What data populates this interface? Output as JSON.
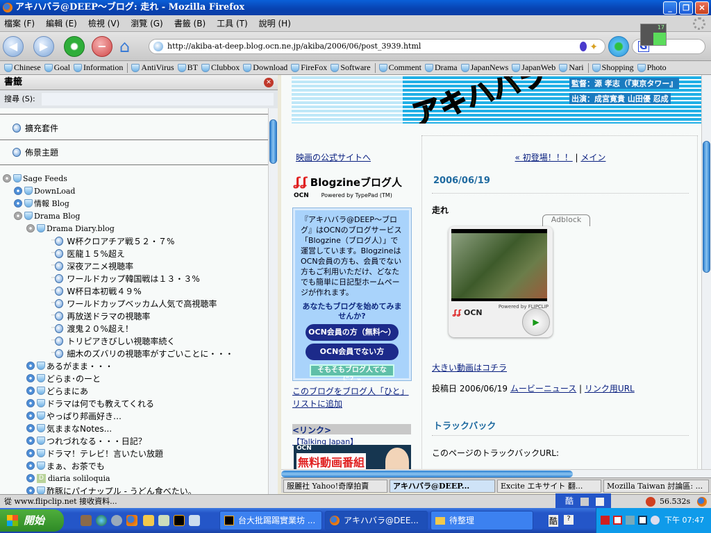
{
  "window": {
    "title": "アキハバラ@DEEP〜ブログ: 走れ - Mozilla Firefox"
  },
  "menu": [
    "檔案 (F)",
    "編輯 (E)",
    "檢視 (V)",
    "瀏覽 (G)",
    "書籤 (B)",
    "工具 (T)",
    "說明 (H)"
  ],
  "nav": {
    "url": "http://akiba-at-deep.blog.ocn.ne.jp/akiba/2006/06/post_3939.html",
    "search_engine": "G",
    "badge": "17"
  },
  "bookmarks": [
    "Chinese",
    "Goal",
    "Information",
    "AntiVirus",
    "BT",
    "Clubbox",
    "Download",
    "FireFox",
    "Software",
    "Comment",
    "Drama",
    "JapanNews",
    "JapanWeb",
    "Nari",
    "Shopping",
    "Photo"
  ],
  "sidebar": {
    "title": "書籤",
    "search_label": "搜尋 (S):",
    "search_value": "",
    "links": [
      "擴充套件",
      "佈景主題"
    ],
    "tree": [
      {
        "label": "Sage Feeds",
        "level": 0,
        "type": "folder-open",
        "serif": true
      },
      {
        "label": "DownLoad",
        "level": 1,
        "type": "folder",
        "serif": true
      },
      {
        "label": "情報 Blog",
        "level": 1,
        "type": "folder",
        "serif": true
      },
      {
        "label": "Drama  Blog",
        "level": 1,
        "type": "folder-open",
        "serif": true
      },
      {
        "label": "Drama Diary.blog",
        "level": 2,
        "type": "folder-open",
        "serif": true
      },
      {
        "label": "W杯クロアチア戦５２・７%",
        "level": 3,
        "type": "item"
      },
      {
        "label": "医龍１５%超え",
        "level": 3,
        "type": "item"
      },
      {
        "label": "深夜アニメ視聴率",
        "level": 3,
        "type": "item"
      },
      {
        "label": "ワールドカップ韓国戦は１３・３%",
        "level": 3,
        "type": "item"
      },
      {
        "label": "W杯日本初戦４９%",
        "level": 3,
        "type": "item"
      },
      {
        "label": "ワールドカップベッカム人気で高視聴率",
        "level": 3,
        "type": "item"
      },
      {
        "label": "再放送ドラマの視聴率",
        "level": 3,
        "type": "item"
      },
      {
        "label": "渡鬼２０%超え！",
        "level": 3,
        "type": "item"
      },
      {
        "label": "トリピアきびしい視聴率続く",
        "level": 3,
        "type": "item"
      },
      {
        "label": "細木のズバリの視聴率がすごいことに・・・",
        "level": 3,
        "type": "item"
      },
      {
        "label": "あるがまま・・・",
        "level": 2,
        "type": "folder"
      },
      {
        "label": "どらま･のーと",
        "level": 2,
        "type": "folder"
      },
      {
        "label": "どらまにあ",
        "level": 2,
        "type": "folder"
      },
      {
        "label": "ドラマは何でも教えてくれる",
        "level": 2,
        "type": "folder"
      },
      {
        "label": "やっぱり邦画好き…",
        "level": 2,
        "type": "folder"
      },
      {
        "label": "気ままなNotes...",
        "level": 2,
        "type": "folder"
      },
      {
        "label": "つれづれなる・・・日記？",
        "level": 2,
        "type": "folder"
      },
      {
        "label": "ドラマ！テレビ！言いたい放題",
        "level": 2,
        "type": "folder"
      },
      {
        "label": "まぁ、お茶でも",
        "level": 2,
        "type": "folder"
      },
      {
        "label": "diaria soliloquia",
        "level": 2,
        "type": "d",
        "serif": true
      },
      {
        "label": "酢豚にパイナップル - うどん食べたい。",
        "level": 2,
        "type": "folder"
      }
    ]
  },
  "page": {
    "banner": {
      "logo": "アキハバラ",
      "director": "監督：源 孝志（『東京タワー』",
      "cast": "出演：成宮寛貴 山田優 忍成"
    },
    "left": {
      "official_link": "映画の公式サイトへ",
      "blogzine_logo": "Blogzineブログ人",
      "blogzine_ocn": "OCN",
      "blogzine_powered": "Powered by TypePad (TM)",
      "box_text": "『アキハバラ@DEEP〜ブログ』はOCNのブログサービス「Blogzine（ブログ人）」で運営しています。BlogzineはOCN会員の方も、会員でない方もご利用いただけ、どなたでも簡単に日記型ホームページが作れます。",
      "box_question": "あなたもブログを始めてみませんか?",
      "btn_member": "OCN会員の方（無料〜）",
      "btn_nonmember": "OCN会員でない方",
      "btn_what": "そもそもブログ人てなに？»",
      "add_list": "このブログをブログ人「ひと」リストに追加",
      "links_header": "<リンク>",
      "talking_japan": "【Talking Japan】",
      "ad_ocn": "OCN",
      "ad_text": "無料動画番組"
    },
    "main": {
      "prev": "« 初登場！！！",
      "sep": "|",
      "main_link": "メイン",
      "date": "2006/06/19",
      "title": "走れ",
      "adblock": "Adblock",
      "video_powered": "Powered by FLIPCLIP",
      "video_ocn": "OCN",
      "big_video": "大きい動画はコチラ",
      "posted_prefix": "投稿日 2006/06/19",
      "category": "ムービーニュース",
      "posted_sep": "|",
      "permalink": "リンク用URL",
      "trackback_title": "トラックバック",
      "trackback_label": "このページのトラックバックURL:"
    }
  },
  "tabs": [
    {
      "label": "服麗社 Yahoo!奇摩拍賣",
      "active": false
    },
    {
      "label": "アキハバラ@DEEP...",
      "active": true
    },
    {
      "label": "Excite エキサイト 翻...",
      "active": false
    },
    {
      "label": "Mozilla Taiwan 討論區: ...",
      "active": false
    }
  ],
  "status": {
    "text": "從 www.flipclip.net 接收資料...",
    "timer": "56.532s",
    "ime": "酷"
  },
  "taskbar": {
    "start": "開始",
    "tasks": [
      {
        "label": "台大批踢踢實業坊 ...",
        "active": false
      },
      {
        "label": "アキハバラ@DEE...",
        "active": true
      },
      {
        "label": "待整理",
        "active": false
      }
    ],
    "ime": "酷",
    "clock": "下午 07:47"
  }
}
